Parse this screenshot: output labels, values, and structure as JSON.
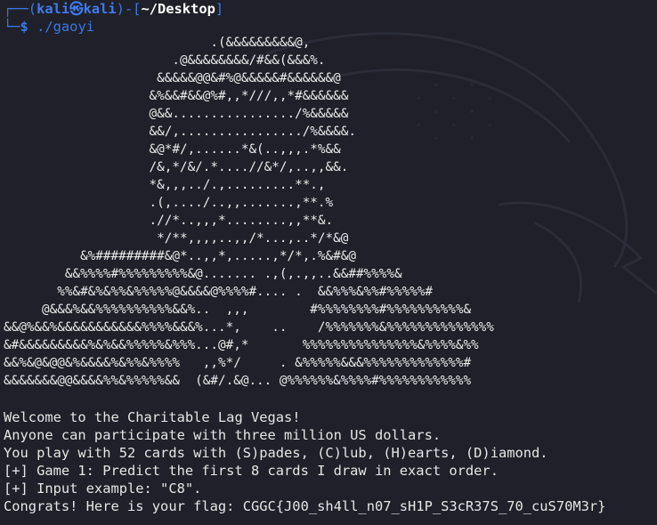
{
  "prompt": {
    "bracket_open": "┌──(",
    "user": "kali",
    "at": "㉿",
    "host": "kali",
    "mid": ")-[",
    "cwd": "~/Desktop",
    "bracket_close": "]",
    "line2_prefix": "└─",
    "dollar": "$",
    "command": "./gaoyi"
  },
  "ascii_art": [
    "                           .(&&&&&&&&&@,",
    "                      .@&&&&&&&&/#&&(&&&%.",
    "                    &&&&&@@&#%@&&&&&#&&&&&&@",
    "                   &%&&#&&@%#,,*///,,*#&&&&&&",
    "                   @&&................/%&&&&&",
    "                   &&/,................/%&&&&.",
    "                   &@*#/,......*&(..,,,.*%&&",
    "                   /&,*/&/.*....//&*/,..,,&&.",
    "                   *&,,,../.,.........**.,",
    "                   .(,..../..,,.......,**.%",
    "                   .//*..,,,*........,,**&.",
    "                    */**,,,,..,,/*...,..*/*&@",
    "          &%#########&@*..,,*,.....,*/*,.%&#&@",
    "        &&%%%%#%%%%%%%%%&@....... .,(,.,,..&&##%%%%&",
    "       %%&#&%&%%&%%%%%@&&&&@%%%%#.... .  &&%%%&%%#%%%%%#",
    "     @&&&%&&%%%%%%%%%%&&%..  ,,,        #%%%%%%%%#%%%%%%%%%%&",
    "&&@%&&%&&&&&&&&&&&%%%%&&&%...*,    ..    /%%%%%%%&%%%%%%%%%%%%%%",
    "&#&&&&&&&&&%&%&&%%%%%&%%%...@#,*       %%%%%%%%%%%%%%%&%%%%&%%",
    "&&%&@&@@&%&&&&%&%%&%%%%   ,,%*/     . &%%%%%&&&%%%%%%%%%%%%%#",
    "&&&&&&&@@&&&&%%&%%%%%&&  (&#/.&@... @%%%%%%&%%%%#%%%%%%%%%%%%"
  ],
  "output_lines": [
    "Welcome to the Charitable Lag Vegas!",
    "Anyone can participate with three million US dollars.",
    "You play with 52 cards with (S)pades, (C)lub, (H)earts, (D)iamond.",
    "[+] Game 1: Predict the first 8 cards I draw in exact order.",
    "[+] Input example: \"C8\".",
    "Congrats! Here is your flag: CGGC{J00_sh4ll_n07_sH1P_S3cR37S_70_cuS70M3r}"
  ],
  "colors": {
    "background": "#1f2029",
    "prompt_accent": "#3a78e6",
    "text": "#e6e6e6"
  }
}
